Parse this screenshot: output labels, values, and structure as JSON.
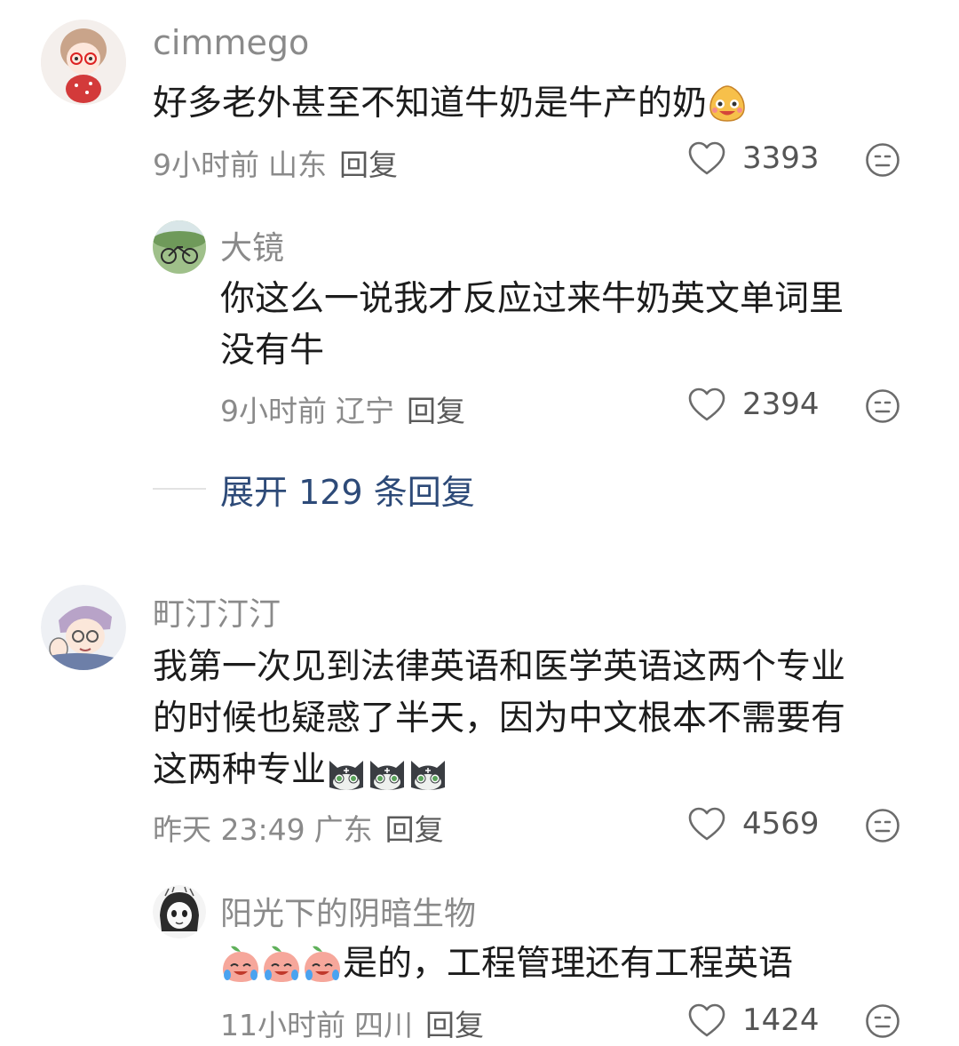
{
  "comments": [
    {
      "username": "cimmego",
      "text": "好多老外甚至不知道牛奶是牛产的奶",
      "emoji": "grinning-face-emoji",
      "time": "9小时前",
      "location": "山东",
      "reply_label": "回复",
      "likes": "3393",
      "avatar": "girl-with-glasses-avatar"
    },
    {
      "username": "大镜",
      "text_lines": [
        "你这么一说我才反应过来牛奶英文单词里",
        "没有牛"
      ],
      "time": "9小时前",
      "location": "辽宁",
      "reply_label": "回复",
      "likes": "2394",
      "avatar": "bicycle-avatar"
    },
    {
      "expand_label": "展开 129 条回复"
    },
    {
      "username": "町汀汀汀",
      "text_lines": [
        "我第一次见到法律英语和医学英语这两个专业",
        "的时候也疑惑了半天，因为中文根本不需要有",
        "这两种专业"
      ],
      "emoji": "cat-face-emoji",
      "time": "昨天 23:49",
      "location": "广东",
      "reply_label": "回复",
      "likes": "4569",
      "avatar": "cartoon-person-avatar"
    },
    {
      "username": "阳光下的阴暗生物",
      "text": "是的，工程管理还有工程英语",
      "emoji": "crying-laughing-peach-emoji",
      "time": "11小时前",
      "location": "四川",
      "reply_label": "回复",
      "likes": "1424",
      "avatar": "manga-girl-avatar"
    }
  ],
  "colors": {
    "username": "#8a8a8a",
    "text": "#1c1c1c",
    "meta": "#8a8a8a",
    "expand_link": "#2d4a78"
  }
}
